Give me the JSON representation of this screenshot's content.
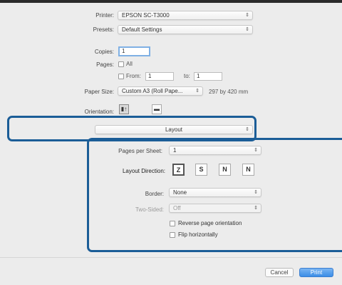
{
  "form": {
    "printer_label": "Printer:",
    "printer_value": "EPSON SC-T3000",
    "presets_label": "Presets:",
    "presets_value": "Default Settings",
    "copies_label": "Copies:",
    "copies_value": "1",
    "pages_label": "Pages:",
    "pages_all": "All",
    "pages_from": "From:",
    "pages_from_value": "1",
    "pages_to": "to:",
    "pages_to_value": "1",
    "paper_size_label": "Paper Size:",
    "paper_size_value": "Custom A3 (Roll Pape...",
    "paper_size_dims": "297 by 420 mm",
    "orientation_label": "Orientation:",
    "orientation_portrait": "▮↑",
    "orientation_landscape": "▬",
    "section_value": "Layout"
  },
  "layout": {
    "pages_per_sheet_label": "Pages per Sheet:",
    "pages_per_sheet_value": "1",
    "layout_direction_label": "Layout Direction:",
    "layout_direction_options": [
      "Z",
      "S",
      "N",
      "N"
    ],
    "border_label": "Border:",
    "border_value": "None",
    "two_sided_label": "Two-Sided:",
    "two_sided_value": "Off",
    "reverse_label": "Reverse page orientation",
    "flip_label": "Flip horizontally"
  },
  "buttons": {
    "cancel": "Cancel",
    "print": "Print"
  },
  "colors": {
    "highlight": "#1b5d97",
    "primary_button": "#3b8de6"
  }
}
